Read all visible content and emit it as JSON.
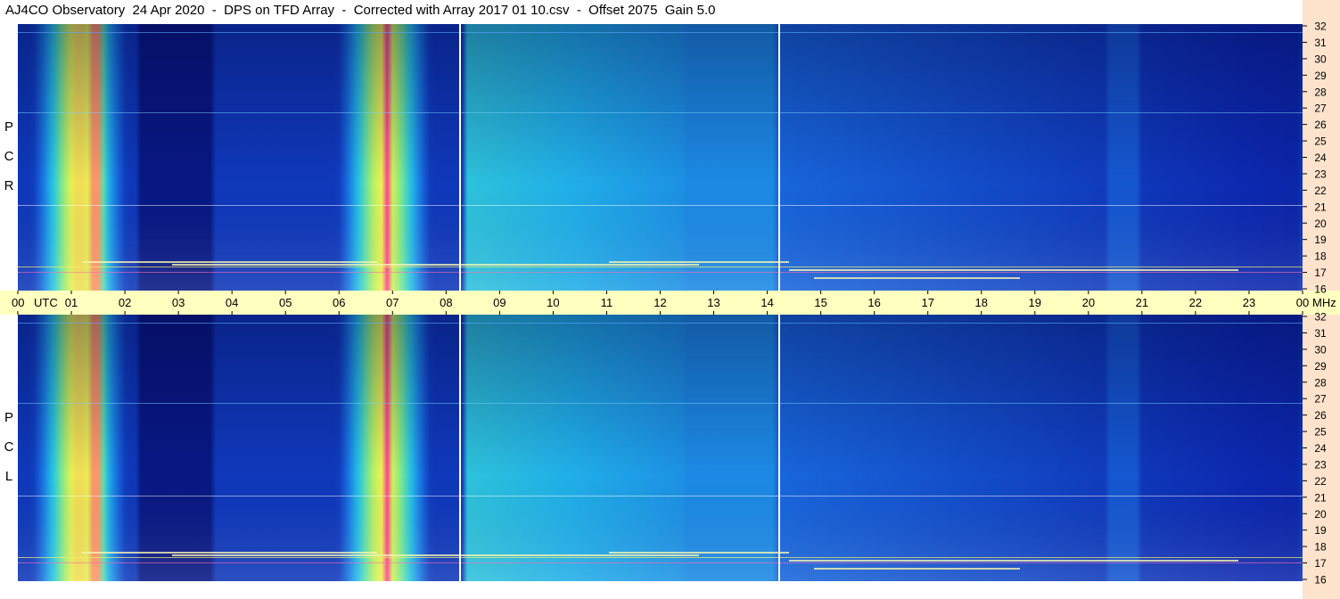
{
  "title": "AJ4CO Observatory  24 Apr 2020  -  DPS on TFD Array  -  Corrected with Array 2017 01 10.csv  -  Offset 2075  Gain 5.0",
  "panels": [
    {
      "letters": [
        "R",
        "C",
        "P"
      ]
    },
    {
      "letters": [
        "L",
        "C",
        "P"
      ]
    }
  ],
  "chart_data": {
    "type": "heatmap",
    "x_label_utc": "UTC",
    "x_ticks": [
      "00",
      "01",
      "02",
      "03",
      "04",
      "05",
      "06",
      "07",
      "08",
      "09",
      "10",
      "11",
      "12",
      "13",
      "14",
      "15",
      "16",
      "17",
      "18",
      "19",
      "20",
      "21",
      "22",
      "23",
      "00"
    ],
    "x_range_hours": [
      0,
      24
    ],
    "y_unit": "MHz",
    "y_ticks": [
      "16",
      "17",
      "18",
      "19",
      "20",
      "21",
      "22",
      "23",
      "24",
      "25",
      "26",
      "27",
      "28",
      "29",
      "30",
      "31",
      "32"
    ],
    "y_range_mhz": [
      16,
      32
    ],
    "colors": {
      "background_low": "#0a1a8c",
      "mid": "#1fa8e6",
      "high": "#f2f25a",
      "peak": "#ff3399",
      "time_band": "#ffffc0",
      "scale_strip": "#fde3cc"
    }
  }
}
